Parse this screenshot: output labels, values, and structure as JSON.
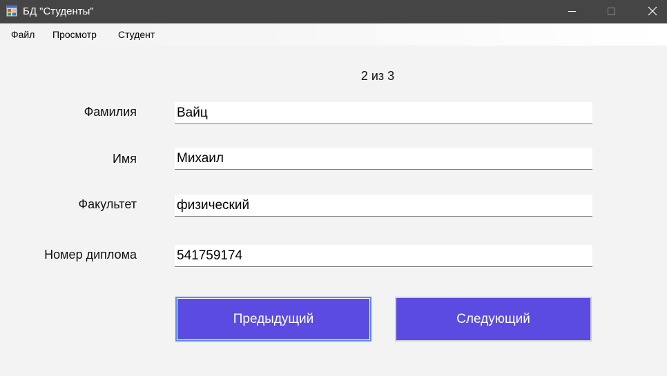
{
  "window": {
    "title": "БД \"Студенты\"",
    "icon": "app-forms-icon"
  },
  "menu": {
    "items": [
      "Файл",
      "Просмотр",
      "Студент"
    ]
  },
  "record": {
    "counter": "2 из 3"
  },
  "form": {
    "surname": {
      "label": "Фамилия",
      "value": "Вайц"
    },
    "name": {
      "label": "Имя",
      "value": "Михаил"
    },
    "faculty": {
      "label": "Факультет",
      "value": "физический"
    },
    "diploma": {
      "label": "Номер диплома",
      "value": "541759174"
    }
  },
  "buttons": {
    "prev_label": "Предыдущий",
    "next_label": "Следующий"
  },
  "colors": {
    "titlebar": "#454545",
    "button_fill": "#5b4be0",
    "focus_border": "#5b8de8"
  }
}
